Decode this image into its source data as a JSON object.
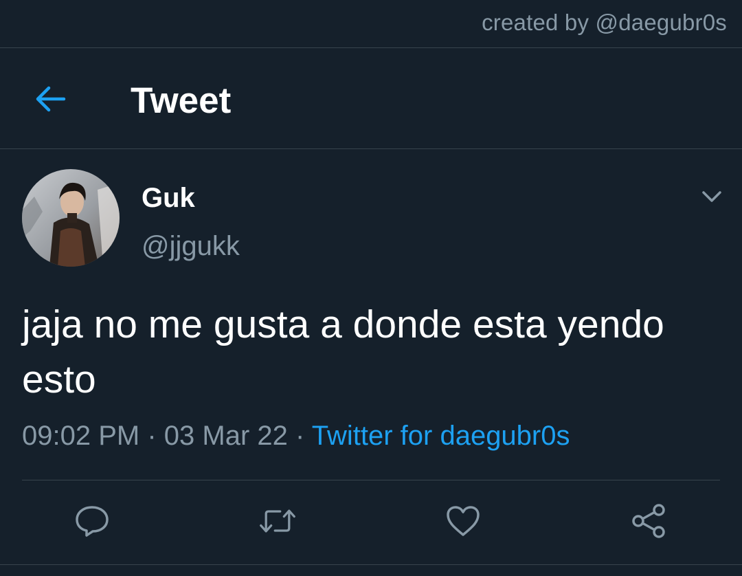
{
  "credit": "created by @daegubr0s",
  "header": {
    "title": "Tweet",
    "back_icon": "arrow-left-icon",
    "accent": "#1da1f2"
  },
  "tweet": {
    "display_name": "Guk",
    "handle": "@jjgukk",
    "text": "jaja no me gusta a donde esta yendo esto",
    "time": "09:02 PM",
    "separator": "·",
    "date": "03 Mar 22",
    "source": "Twitter for daegubr0s"
  },
  "actions": [
    {
      "icon": "reply-icon"
    },
    {
      "icon": "retweet-icon"
    },
    {
      "icon": "like-icon"
    },
    {
      "icon": "share-icon"
    }
  ],
  "colors": {
    "background": "#15202b",
    "secondary_text": "#8899a6",
    "divider": "#38444d",
    "link": "#1da1f2"
  }
}
